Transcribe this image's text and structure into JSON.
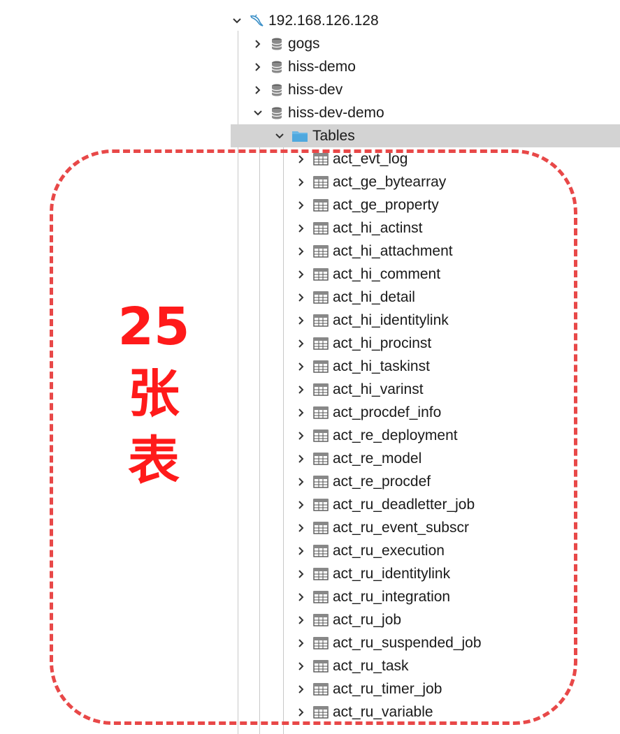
{
  "connection": {
    "label": "192.168.126.128",
    "expanded": true
  },
  "databases": [
    {
      "label": "gogs",
      "expanded": false
    },
    {
      "label": "hiss-demo",
      "expanded": false
    },
    {
      "label": "hiss-dev",
      "expanded": false
    },
    {
      "label": "hiss-dev-demo",
      "expanded": true
    }
  ],
  "tables_folder": {
    "label": "Tables",
    "expanded": true,
    "selected": true
  },
  "tables": [
    "act_evt_log",
    "act_ge_bytearray",
    "act_ge_property",
    "act_hi_actinst",
    "act_hi_attachment",
    "act_hi_comment",
    "act_hi_detail",
    "act_hi_identitylink",
    "act_hi_procinst",
    "act_hi_taskinst",
    "act_hi_varinst",
    "act_procdef_info",
    "act_re_deployment",
    "act_re_model",
    "act_re_procdef",
    "act_ru_deadletter_job",
    "act_ru_event_subscr",
    "act_ru_execution",
    "act_ru_identitylink",
    "act_ru_integration",
    "act_ru_job",
    "act_ru_suspended_job",
    "act_ru_task",
    "act_ru_timer_job",
    "act_ru_variable"
  ],
  "annotation": {
    "lines": [
      "25",
      "张",
      "表"
    ],
    "color": "#ff1a1a",
    "border_color": "#e84848"
  },
  "icons": {
    "connection": "mysql-dolphin-icon",
    "database": "database-icon",
    "folder": "folder-icon",
    "table": "table-icon",
    "expand": "chevron-right-icon",
    "collapse": "chevron-down-icon"
  }
}
